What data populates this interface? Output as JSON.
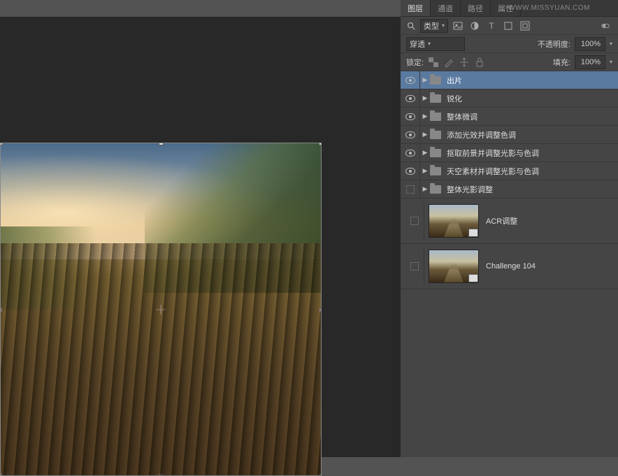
{
  "watermark": "WWW.MISSYUAN.COM",
  "tabs": {
    "layers": "图层",
    "channels": "通道",
    "paths": "路径",
    "properties": "属性"
  },
  "filter": {
    "type_label": "类型"
  },
  "blend": {
    "mode": "穿透",
    "opacity_label": "不透明度:",
    "opacity_value": "100%"
  },
  "lock": {
    "label": "锁定:",
    "fill_label": "填充:",
    "fill_value": "100%"
  },
  "groups": [
    {
      "name": "出片",
      "visible": true,
      "selected": true
    },
    {
      "name": "锐化",
      "visible": true,
      "selected": false
    },
    {
      "name": "整体微调",
      "visible": true,
      "selected": false
    },
    {
      "name": "添加光效并调整色调",
      "visible": true,
      "selected": false
    },
    {
      "name": "抠取前景并调整光影与色调",
      "visible": true,
      "selected": false
    },
    {
      "name": "天空素材并调整光影与色调",
      "visible": true,
      "selected": false
    },
    {
      "name": "整体光影调整",
      "visible": false,
      "selected": false
    }
  ],
  "image_layers": [
    {
      "name": "ACR调整",
      "visible": false
    },
    {
      "name": "Challenge 104",
      "visible": false
    }
  ]
}
